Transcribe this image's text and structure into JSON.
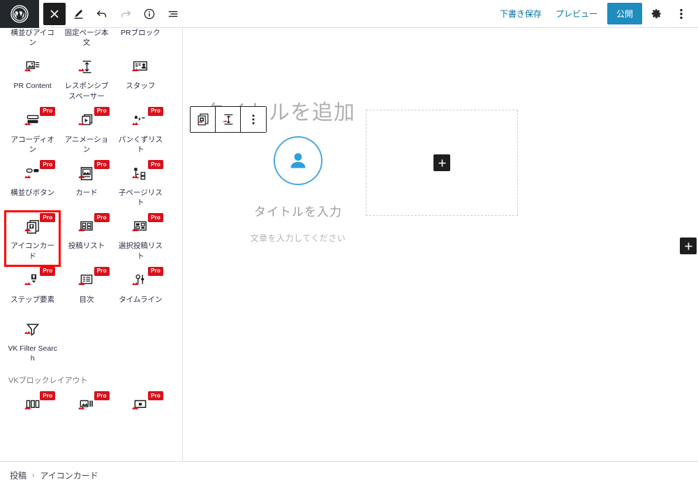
{
  "topbar": {
    "logo": "wordpress-logo",
    "tools": [
      {
        "name": "close-inserter-button",
        "icon": "close-icon",
        "state": "active"
      },
      {
        "name": "edit-tool-button",
        "icon": "pencil-icon",
        "state": "normal"
      },
      {
        "name": "undo-button",
        "icon": "undo-icon",
        "state": "normal"
      },
      {
        "name": "redo-button",
        "icon": "redo-icon",
        "state": "disabled"
      },
      {
        "name": "details-button",
        "icon": "info-icon",
        "state": "normal"
      },
      {
        "name": "list-view-button",
        "icon": "list-view-icon",
        "state": "normal"
      }
    ],
    "save_draft_label": "下書き保存",
    "preview_label": "プレビュー",
    "publish_label": "公開",
    "settings_icon": "gear-icon",
    "more_icon": "more-vertical-icon"
  },
  "inserter": {
    "blocks": [
      {
        "label": "横並びアイコン",
        "icon": "inline-icons-icon",
        "pro": false,
        "selected": false,
        "clipped": true
      },
      {
        "label": "固定ページ本文",
        "icon": "page-content-icon",
        "pro": false,
        "selected": false,
        "clipped": true
      },
      {
        "label": "PRブロック",
        "icon": "pr-block-icon",
        "pro": false,
        "selected": false,
        "clipped": true
      },
      {
        "label": "PR Content",
        "icon": "pr-content-icon",
        "pro": false,
        "selected": false
      },
      {
        "label": "レスポンシブスペーサー",
        "icon": "responsive-spacer-icon",
        "pro": false,
        "selected": false
      },
      {
        "label": "スタッフ",
        "icon": "staff-icon",
        "pro": false,
        "selected": false
      },
      {
        "label": "アコーディオン",
        "icon": "accordion-icon",
        "pro": true,
        "selected": false
      },
      {
        "label": "アニメーション",
        "icon": "animation-icon",
        "pro": true,
        "selected": false
      },
      {
        "label": "パンくずリスト",
        "icon": "breadcrumb-icon",
        "pro": true,
        "selected": false
      },
      {
        "label": "横並びボタン",
        "icon": "inline-buttons-icon",
        "pro": true,
        "selected": false
      },
      {
        "label": "カード",
        "icon": "card-icon",
        "pro": true,
        "selected": false
      },
      {
        "label": "子ページリスト",
        "icon": "child-page-list-icon",
        "pro": true,
        "selected": false
      },
      {
        "label": "アイコンカード",
        "icon": "icon-card-icon",
        "pro": true,
        "selected": true
      },
      {
        "label": "投稿リスト",
        "icon": "post-list-icon",
        "pro": true,
        "selected": false
      },
      {
        "label": "選択投稿リスト",
        "icon": "selected-post-list-icon",
        "pro": true,
        "selected": false
      },
      {
        "label": "ステップ要素",
        "icon": "step-icon",
        "pro": true,
        "selected": false
      },
      {
        "label": "目次",
        "icon": "table-of-contents-icon",
        "pro": true,
        "selected": false
      },
      {
        "label": "タイムライン",
        "icon": "timeline-icon",
        "pro": true,
        "selected": false
      },
      {
        "label": "VK Filter Search",
        "icon": "filter-search-icon",
        "pro": false,
        "selected": false
      }
    ],
    "section_title": "VKブロックレイアウト",
    "section_blocks": [
      {
        "label": "",
        "icon": "columns-icon",
        "pro": true,
        "selected": false
      },
      {
        "label": "",
        "icon": "media-text-icon",
        "pro": true,
        "selected": false
      },
      {
        "label": "",
        "icon": "box-icon",
        "pro": true,
        "selected": false
      }
    ]
  },
  "canvas": {
    "post_title_placeholder": "タイトルを追加",
    "block_toolbar": [
      {
        "name": "block-type-icon-card-button",
        "icon": "icon-card-icon"
      },
      {
        "name": "block-spacer-button",
        "icon": "responsive-spacer-icon"
      },
      {
        "name": "block-options-button",
        "icon": "more-vertical-icon"
      }
    ],
    "icon_card": {
      "icon": "person-icon",
      "icon_color": "#2a9fe0",
      "circle_color": "#4aa8e0",
      "title_placeholder": "タイトルを入力",
      "body_placeholder": "文章を入力してください"
    },
    "placeholder_block": {
      "icon": "plus-icon"
    },
    "right_adder": {
      "icon": "plus-icon"
    }
  },
  "breadcrumb": {
    "items": [
      "投稿",
      "アイコンカード"
    ],
    "separator": "›"
  }
}
